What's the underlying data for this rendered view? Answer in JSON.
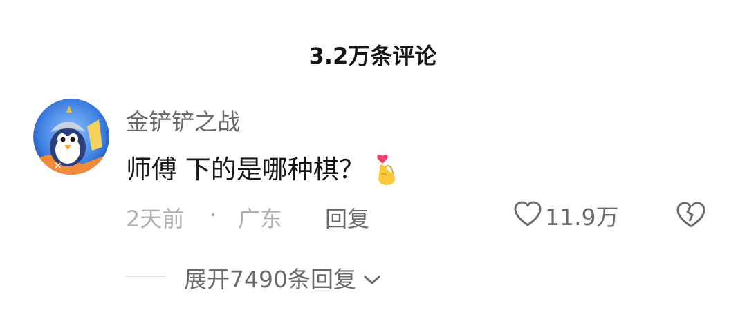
{
  "header": {
    "title": "3.2万条评论"
  },
  "comment": {
    "username": "金铲铲之战",
    "text": "师傅 下的是哪种棋？",
    "emoji": "finger-heart-emoji",
    "time": "2天前",
    "separator": "·",
    "location": "广东",
    "reply_label": "回复",
    "like_count": "11.9万"
  },
  "replies": {
    "expand_label": "展开7490条回复"
  },
  "colors": {
    "title": "#161616",
    "secondary": "#6a6a6a",
    "meta": "#b0b0b0",
    "avatar_bg": "#5a8ce0"
  },
  "icons": [
    "heart-outline-icon",
    "broken-heart-icon",
    "chevron-down-icon"
  ]
}
